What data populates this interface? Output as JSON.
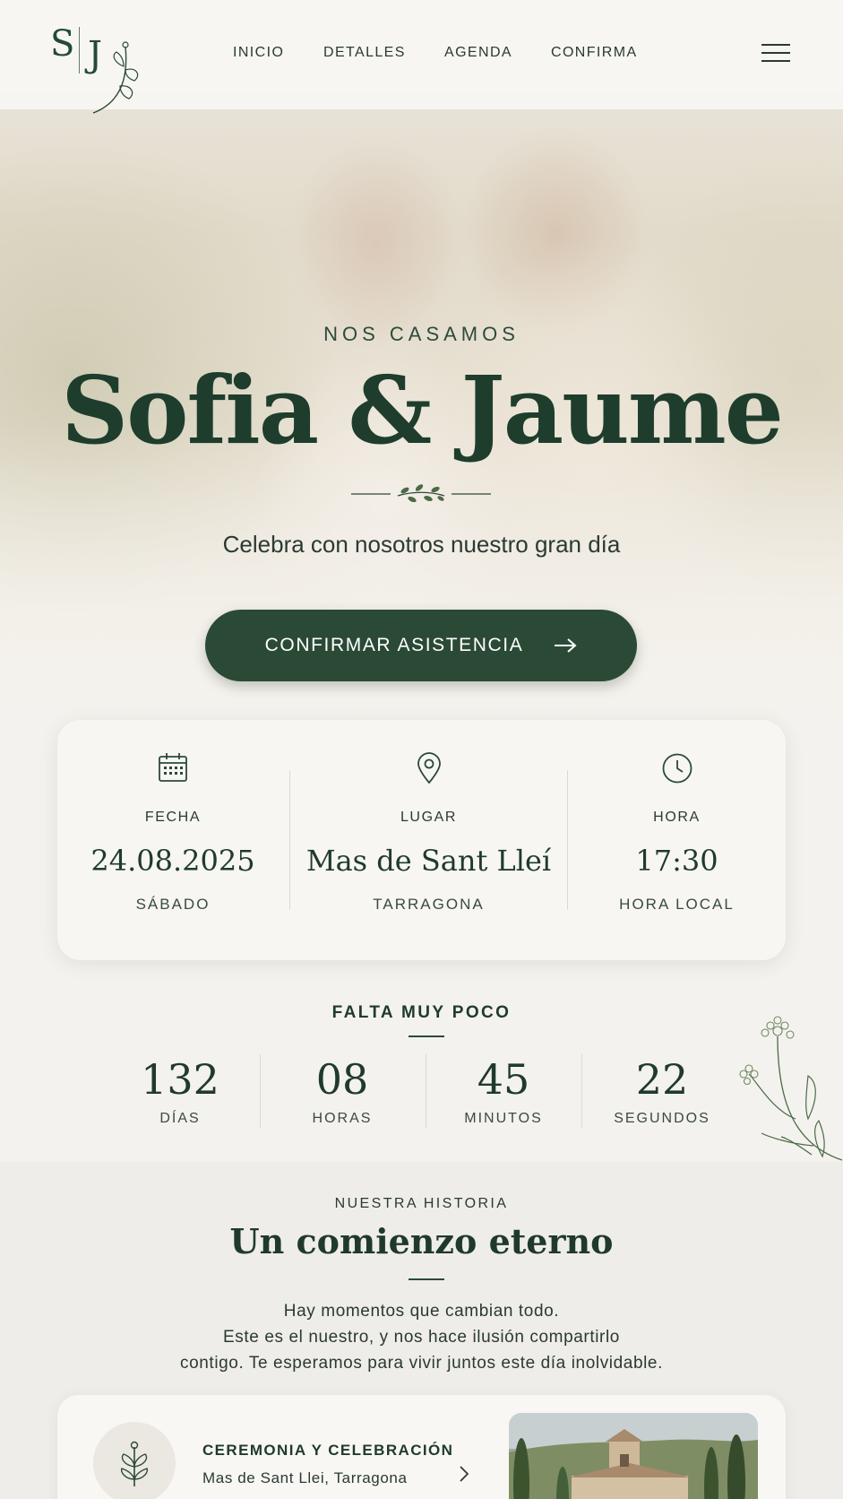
{
  "header": {
    "logo": {
      "initial_1": "S",
      "initial_2": "J"
    },
    "nav": [
      {
        "label": "INICIO"
      },
      {
        "label": "DETALLES"
      },
      {
        "label": "AGENDA"
      },
      {
        "label": "CONFIRMA"
      }
    ],
    "menu_icon": "hamburger-icon"
  },
  "hero": {
    "eyebrow": "NOS CASAMOS",
    "names": "Sofia & Jaume",
    "tagline": "Celebra con nosotros nuestro gran día",
    "cta_label": "CONFIRMAR ASISTENCIA",
    "cta_icon": "arrow-right-icon"
  },
  "info": [
    {
      "icon": "calendar-icon",
      "label": "FECHA",
      "value": "24.08.2025",
      "sub": "SÁBADO"
    },
    {
      "icon": "map-pin-icon",
      "label": "LUGAR",
      "value": "Mas de Sant Lleí",
      "sub": "TARRAGONA"
    },
    {
      "icon": "clock-icon",
      "label": "HORA",
      "value": "17:30",
      "sub": "HORA LOCAL"
    }
  ],
  "countdown": {
    "title": "FALTA MUY POCO",
    "units": [
      {
        "value": "132",
        "label": "DÍAS"
      },
      {
        "value": "08",
        "label": "HORAS"
      },
      {
        "value": "45",
        "label": "MINUTOS"
      },
      {
        "value": "22",
        "label": "SEGUNDOS"
      }
    ]
  },
  "story": {
    "eyebrow": "NUESTRA HISTORIA",
    "title": "Un comienzo eterno",
    "lines": [
      "Hay momentos que cambian todo.",
      "Este es el nuestro, y nos hace ilusión compartirlo",
      "contigo. Te esperamos para vivir juntos este día inolvidable."
    ]
  },
  "event": {
    "icon": "sprig-icon",
    "title": "CEREMONIA Y CELEBRACIÓN",
    "place": "Mas de Sant Llei, Tarragona",
    "chevron": "chevron-right-icon"
  },
  "colors": {
    "accent": "#2b4a36",
    "text": "#1f3a2c",
    "background": "#f4f2ee"
  }
}
